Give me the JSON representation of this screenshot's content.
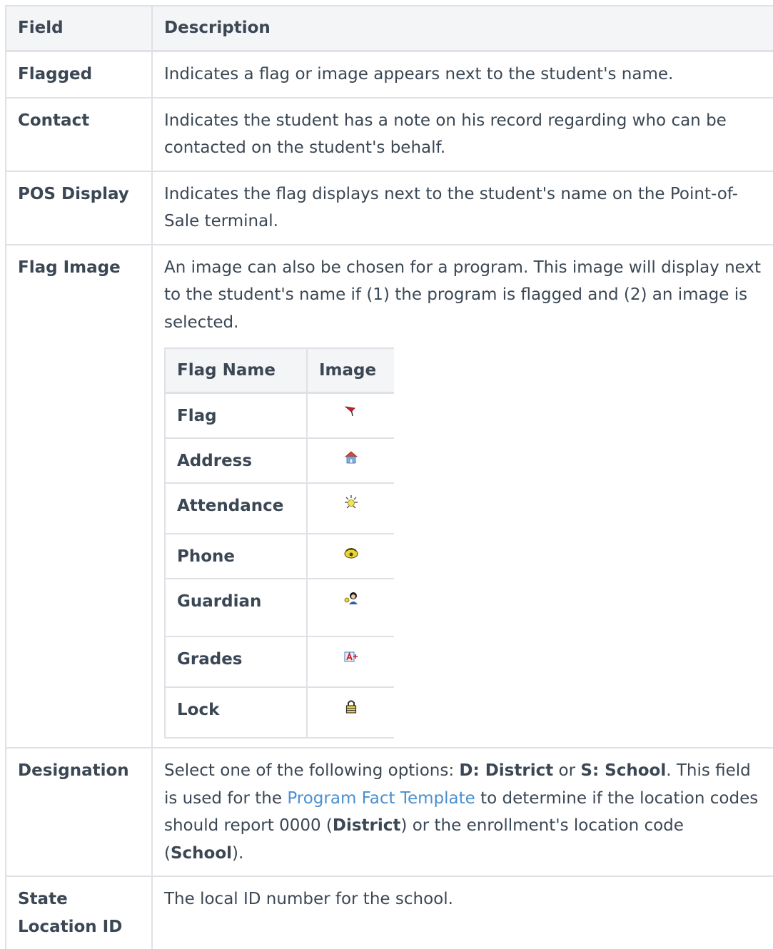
{
  "header": {
    "field": "Field",
    "description": "Description"
  },
  "rows": [
    {
      "field": "Flagged",
      "description": "Indicates a flag or image appears next to the student's name."
    },
    {
      "field": "Contact",
      "description": "Indicates the student has a note on his record regarding who can be contacted on the student's behalf."
    },
    {
      "field": "POS Display",
      "description": "Indicates the flag displays next to the student's name on the Point-of-Sale terminal."
    },
    {
      "field": "Flag Image",
      "description": "An image can also be chosen for a program. This image will display next to the student's name if (1) the program is flagged and (2) an image is selected."
    },
    {
      "field": "Designation",
      "d1": "Select one of the following options: ",
      "d2": "D: District",
      "d3": " or ",
      "d4": "S: School",
      "d5": ". This field is used for the ",
      "link": "Program Fact Template",
      "d6": " to determine if the location codes should report 0000 (",
      "d7": "District",
      "d8": ") or the enrollment's location code (",
      "d9": "School",
      "d10": ")."
    },
    {
      "field": "State Location ID",
      "description": "The local ID number for the school."
    }
  ],
  "flag_table": {
    "header": {
      "name": "Flag Name",
      "image": "Image"
    },
    "items": [
      {
        "name": "Flag",
        "icon": "red-flag-icon"
      },
      {
        "name": "Address",
        "icon": "house-icon"
      },
      {
        "name": "Attendance",
        "icon": "alarm-bell-icon"
      },
      {
        "name": "Phone",
        "icon": "telephone-icon"
      },
      {
        "name": "Guardian",
        "icon": "guardian-person-icon"
      },
      {
        "name": "Grades",
        "icon": "grade-a-plus-icon"
      },
      {
        "name": "Lock",
        "icon": "padlock-icon"
      }
    ]
  },
  "colors": {
    "text": "#3b4754",
    "link": "#4a8fd0",
    "border": "#dfe1e6",
    "header_bg": "#f4f5f7"
  }
}
